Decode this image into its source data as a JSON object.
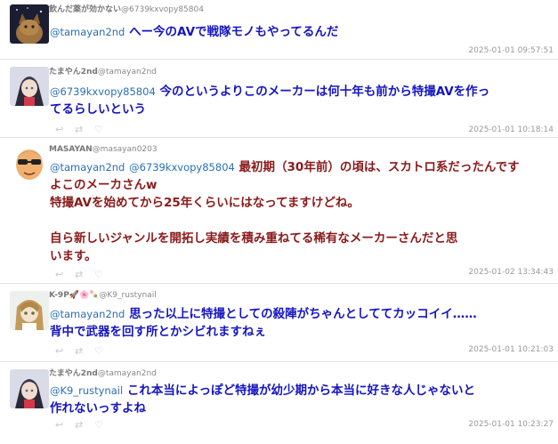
{
  "posts": [
    {
      "display_name": "飲んだ薬が効かない",
      "handle": "@6739kxvopy85804",
      "mentions": [
        "@tamayan2nd"
      ],
      "text_lines": [
        "へー今のAVで戦隊モノもやってるんだ"
      ],
      "timestamp": "2025-01-01 09:57:51",
      "avatar": "cat-photo"
    },
    {
      "display_name": "たまやん2nd",
      "handle": "@tamayan2nd",
      "mentions": [
        "@6739kxvopy85804"
      ],
      "text_lines": [
        "今のというよりこのメーカーは何十年も前から特撮AVを作っ",
        "てるらしいという"
      ],
      "timestamp": "2025-01-01 10:18:14",
      "avatar": "anime-figure"
    },
    {
      "display_name": "MASAYAN",
      "handle": "@masayan0203",
      "mentions": [
        "@tamayan2nd",
        "@6739kxvopy85804"
      ],
      "text_lines": [
        "最初期（30年前）の頃は、スカトロ系だったんです",
        "よこのメーカさんw",
        "特撮AVを始めてから25年くらいにはなってますけどね。",
        "",
        "自ら新しいジャンルを開拓し実績を積み重ねてる稀有なメーカーさんだと思",
        "います。"
      ],
      "timestamp": "2025-01-02 13:34:43",
      "avatar": "sunglasses-face"
    },
    {
      "display_name": "K-9P🚀🌸🍡",
      "handle": "@K9_rustynail",
      "mentions": [
        "@tamayan2nd"
      ],
      "text_lines": [
        "思った以上に特撮としての殺陣がちゃんとしててカッコイイ……",
        "背中で武器を回す所とかシビれますねぇ"
      ],
      "timestamp": "2025-01-01 10:21:03",
      "avatar": "anime-girl"
    },
    {
      "display_name": "たまやん2nd",
      "handle": "@tamayan2nd",
      "mentions": [
        "@K9_rustynail"
      ],
      "text_lines": [
        "これ本当によっぽど特撮が幼少期から本当に好きな人じゃないと",
        "作れないっすよね"
      ],
      "timestamp": "2025-01-01 10:23:27",
      "avatar": "anime-figure"
    }
  ],
  "icons": {
    "reply": "reply-icon",
    "retweet": "retweet-icon",
    "like": "like-icon"
  },
  "colors": {
    "body_text": "#1515c0",
    "body_text_alt": "#8b1a1a",
    "mention": "#2a6fb5",
    "timestamp": "#999999"
  }
}
